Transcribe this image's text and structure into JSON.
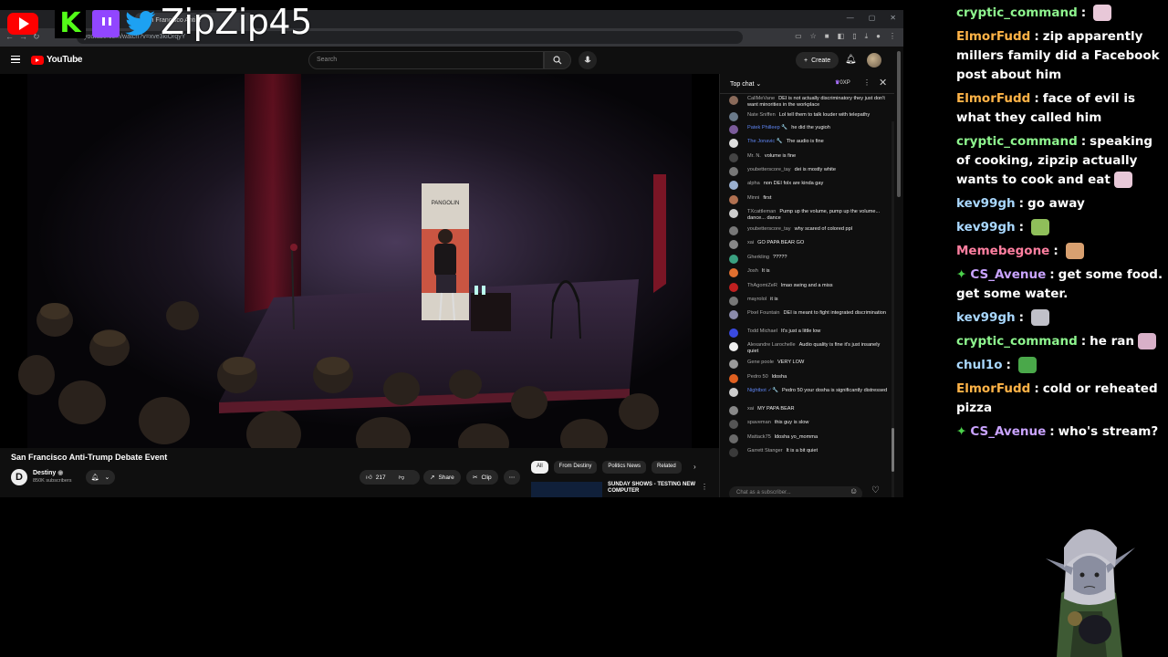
{
  "overlay": {
    "handle": "ZipZip45",
    "icons": [
      "youtube-icon",
      "kick-icon",
      "twitch-icon",
      "twitter-icon"
    ]
  },
  "browser": {
    "tab_title": "San Francisco Anti...",
    "url": "youtube.com/watch?v=xve3kiOrqyY",
    "win_controls": [
      "—",
      "▢",
      "✕"
    ]
  },
  "youtube": {
    "logo_text": "YouTube",
    "search_placeholder": "Search",
    "create_label": "Create",
    "video_title": "San Francisco Anti-Trump Debate Event",
    "channel": {
      "name": "Destiny",
      "subscribers": "850K subscribers",
      "avatar_letter": "D"
    },
    "likes": "217",
    "share_label": "Share",
    "clip_label": "Clip",
    "chips": [
      "All",
      "From Destiny",
      "Politics News",
      "Related"
    ],
    "recommended_title": "SUNDAY SHOWS - TESTING NEW COMPUTER",
    "banner_text": "PANGOLIN"
  },
  "live_chat": {
    "title": "Top chat",
    "xp": "0XP",
    "input_placeholder": "Chat as a subscriber...",
    "messages": [
      {
        "author": "CallMeVane",
        "text": "DEI is not actually discriminatory they just don't want minorities in the workplace",
        "color": "#8a6a5a",
        "mod": false
      },
      {
        "author": "Nate Sniffen",
        "text": "Lol tell them to talk louder with telepathy",
        "color": "#6a7a8a",
        "mod": false
      },
      {
        "author": "Patek Philleep 🔧",
        "text": "he did the yugioh",
        "color": "#7a5a9a",
        "mod": true
      },
      {
        "author": "The Jonavic 🔧",
        "text": "The audio is fine",
        "color": "#ddd",
        "mod": true
      },
      {
        "author": "Mr. N.",
        "text": "volume is fine",
        "color": "#444",
        "mod": false
      },
      {
        "author": "youbetterscore_tay",
        "text": "dei is mostly white",
        "color": "#777",
        "mod": false
      },
      {
        "author": "alpha",
        "text": "non DEI folx are kinda gay",
        "color": "#9ab0d0",
        "mod": false
      },
      {
        "author": "Minni",
        "text": "first",
        "color": "#b07050",
        "mod": false
      },
      {
        "author": "TXcattleman",
        "text": "Pump up the volume, pump up the volume... dance... dance",
        "color": "#ccc",
        "mod": false
      },
      {
        "author": "youbetterscore_tay",
        "text": "why scared of colored ppl",
        "color": "#777",
        "mod": false
      },
      {
        "author": "xai",
        "text": "GO PAPA BEAR GO",
        "color": "#888",
        "mod": false
      },
      {
        "author": "Gherkling",
        "text": "?????",
        "color": "#3aa080",
        "mod": false
      },
      {
        "author": "Josh",
        "text": "It is",
        "color": "#e07030",
        "mod": false
      },
      {
        "author": "ThAgomiZeR",
        "text": "lmao swing and a miss",
        "color": "#c02020",
        "mod": false
      },
      {
        "author": "mayrolol",
        "text": "it is",
        "color": "#777",
        "mod": false
      },
      {
        "author": "Pixel Fountain",
        "text": "DEI is meant to fight integrated discrimination",
        "color": "#8a8aaa",
        "mod": false
      },
      {
        "author": "Todd Michael",
        "text": "It's just a little low",
        "color": "#3a4ae0",
        "mod": false
      },
      {
        "author": "Alexandre Larochelle",
        "text": "Audio quality is fine it's just insanely quiet",
        "color": "#eee",
        "mod": false
      },
      {
        "author": "Gene poole",
        "text": "VERY LOW",
        "color": "#999",
        "mod": false
      },
      {
        "author": "Pedro 50",
        "text": "ldosha",
        "color": "#e06020",
        "mod": false
      },
      {
        "author": "Nightbot ✓🔧",
        "text": "Pedro 50 your dosha is significantly distressed",
        "color": "#ccc",
        "mod": true
      },
      {
        "author": "xai",
        "text": "MY PAPA BEAR",
        "color": "#888",
        "mod": false
      },
      {
        "author": "spaveman",
        "text": "this guy is slow",
        "color": "#555",
        "mod": false
      },
      {
        "author": "Mattack75",
        "text": "ldosha yo_momma",
        "color": "#6a6a6a",
        "mod": false
      },
      {
        "author": "Garrett Stanger",
        "text": "It is a bit quiet",
        "color": "#3a3a3a",
        "mod": false
      }
    ]
  },
  "stream_chat": [
    {
      "user": "cryptic_command",
      "color": "#8ef58e",
      "text": "",
      "emote": "anime-girl-emote",
      "badge": false
    },
    {
      "user": "ElmorFudd",
      "color": "#ffb347",
      "text": "zip apparently millers family did a Facebook post about him",
      "emote": "",
      "badge": false
    },
    {
      "user": "ElmorFudd",
      "color": "#ffb347",
      "text": "face of evil is what they called him",
      "emote": "",
      "badge": false
    },
    {
      "user": "cryptic_command",
      "color": "#8ef58e",
      "text": "speaking of cooking, zipzip actually wants to cook and eat",
      "emote": "anime-girl-emote",
      "badge": false
    },
    {
      "user": "kev99gh",
      "color": "#a9d8ff",
      "text": "go away",
      "emote": "",
      "badge": false
    },
    {
      "user": "kev99gh",
      "color": "#a9d8ff",
      "text": "",
      "emote": "frog-emote",
      "badge": false
    },
    {
      "user": "Memebegone",
      "color": "#ff7fa0",
      "text": "",
      "emote": "cat-emote",
      "badge": false
    },
    {
      "user": "CS_Avenue",
      "color": "#c9a3ff",
      "text": "get some food. get some water.",
      "emote": "",
      "badge": true
    },
    {
      "user": "kev99gh",
      "color": "#a9d8ff",
      "text": "",
      "emote": "cat-face-emote",
      "badge": false
    },
    {
      "user": "cryptic_command",
      "color": "#8ef58e",
      "text": "he ran",
      "emote": "running-girl-emote",
      "badge": false
    },
    {
      "user": "chul1o",
      "color": "#a9d8ff",
      "text": "",
      "emote": "pepe-emote",
      "badge": false
    },
    {
      "user": "ElmorFudd",
      "color": "#ffb347",
      "text": "cold or reheated pizza",
      "emote": "",
      "badge": false
    },
    {
      "user": "CS_Avenue",
      "color": "#c9a3ff",
      "text": "who's stream?",
      "emote": "",
      "badge": true
    }
  ]
}
